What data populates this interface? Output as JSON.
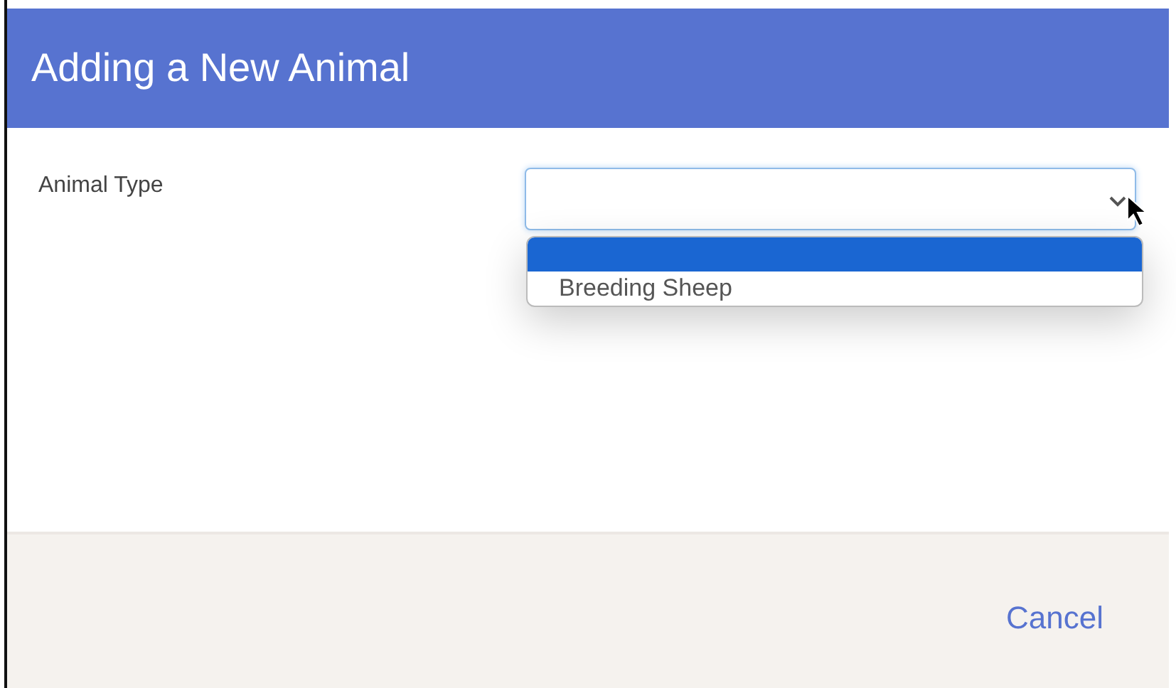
{
  "dialog": {
    "title": "Adding a New Animal"
  },
  "form": {
    "label": "Animal Type",
    "dropdown": {
      "expanded": true,
      "options": [
        {
          "selected": true
        },
        {
          "label": "Breeding Sheep",
          "selected": false
        }
      ]
    }
  },
  "footer": {
    "buttons": [
      "Cancel"
    ]
  }
}
